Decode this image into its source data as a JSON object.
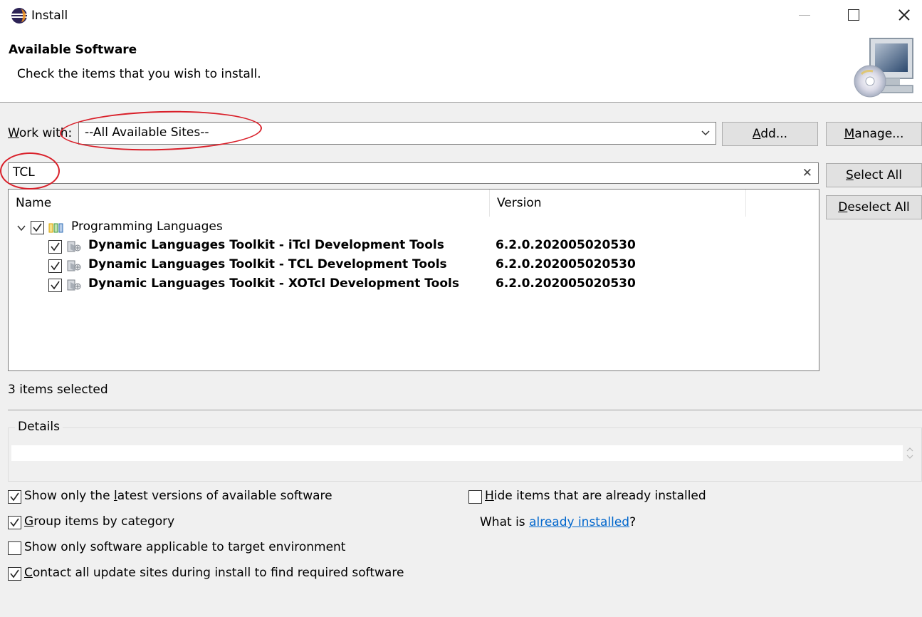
{
  "window": {
    "title": "Install",
    "app_icon": "eclipse-icon",
    "controls": [
      "minimize-icon",
      "maximize-icon",
      "close-icon"
    ]
  },
  "header": {
    "title": "Available Software",
    "description": "Check the items that you wish to install.",
    "banner_icon": "install-software-banner-icon"
  },
  "work_with": {
    "label_prefix": "W",
    "label_rest": "ork with:",
    "value": "--All Available Sites--",
    "add_label_pre": "A",
    "add_label_rest": "dd...",
    "manage_label_pre": "M",
    "manage_label_rest": "anage..."
  },
  "filter": {
    "value": "TCL",
    "clear_icon": "clear-icon"
  },
  "buttons": {
    "select_all_pre": "S",
    "select_all_rest": "elect All",
    "deselect_all_pre": "D",
    "deselect_all_rest": "eselect All"
  },
  "table": {
    "columns": [
      "Name",
      "Version"
    ],
    "category": {
      "name": "Programming Languages",
      "checked": true,
      "expanded": true,
      "icon": "category-icon"
    },
    "items": [
      {
        "name": "Dynamic Languages Toolkit - iTcl Development Tools",
        "version": "6.2.0.202005020530",
        "checked": true,
        "icon": "feature-icon"
      },
      {
        "name": "Dynamic Languages Toolkit - TCL Development Tools",
        "version": "6.2.0.202005020530",
        "checked": true,
        "icon": "feature-icon"
      },
      {
        "name": "Dynamic Languages Toolkit - XOTcl Development Tools",
        "version": "6.2.0.202005020530",
        "checked": true,
        "icon": "feature-icon"
      }
    ]
  },
  "status_text": "3 items selected",
  "details": {
    "label": "Details",
    "text": ""
  },
  "options": {
    "latest_pre": "Show only the ",
    "latest_u": "l",
    "latest_post": "atest versions of available software",
    "latest_checked": true,
    "group_u": "G",
    "group_post": "roup items by category",
    "group_checked": true,
    "target_text": "Show only software applicable to target environment",
    "target_checked": false,
    "contact_u": "C",
    "contact_post": "ontact all update sites during install to find required software",
    "contact_checked": true,
    "hide_u": "H",
    "hide_post": "ide items that are already installed",
    "hide_checked": false,
    "what_is_pre": "What is ",
    "what_is_link": "already installed",
    "what_is_post": "?"
  },
  "colors": {
    "annotation": "#d9202a",
    "link": "#0066cc",
    "category_icon_bars": [
      "#d9a400",
      "#3a9a3a",
      "#2f6db5"
    ]
  }
}
